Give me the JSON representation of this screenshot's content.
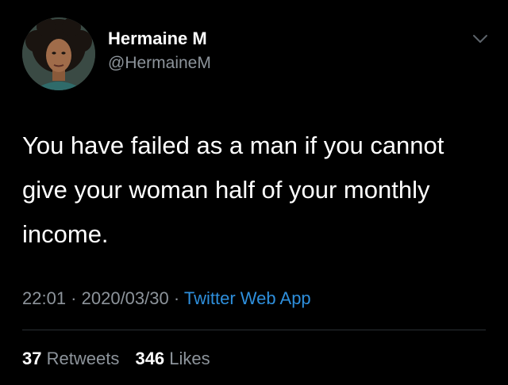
{
  "tweet": {
    "author": {
      "display_name": "Hermaine M",
      "handle": "@HermaineM",
      "avatar_icon": "profile-photo"
    },
    "more_icon": "chevron-down-icon",
    "text": "You have failed as a man if you cannot give your woman half of your monthly income.",
    "meta": {
      "time": "22:01",
      "separator": " · ",
      "date": "2020/03/30",
      "source": "Twitter Web App"
    },
    "stats": {
      "retweets_count": "37",
      "retweets_label": "Retweets",
      "likes_count": "346",
      "likes_label": "Likes"
    }
  },
  "colors": {
    "background": "#000000",
    "primary_text": "#ffffff",
    "secondary_text": "#8d949b",
    "link": "#2e8fdc",
    "divider": "#2a2f34"
  }
}
